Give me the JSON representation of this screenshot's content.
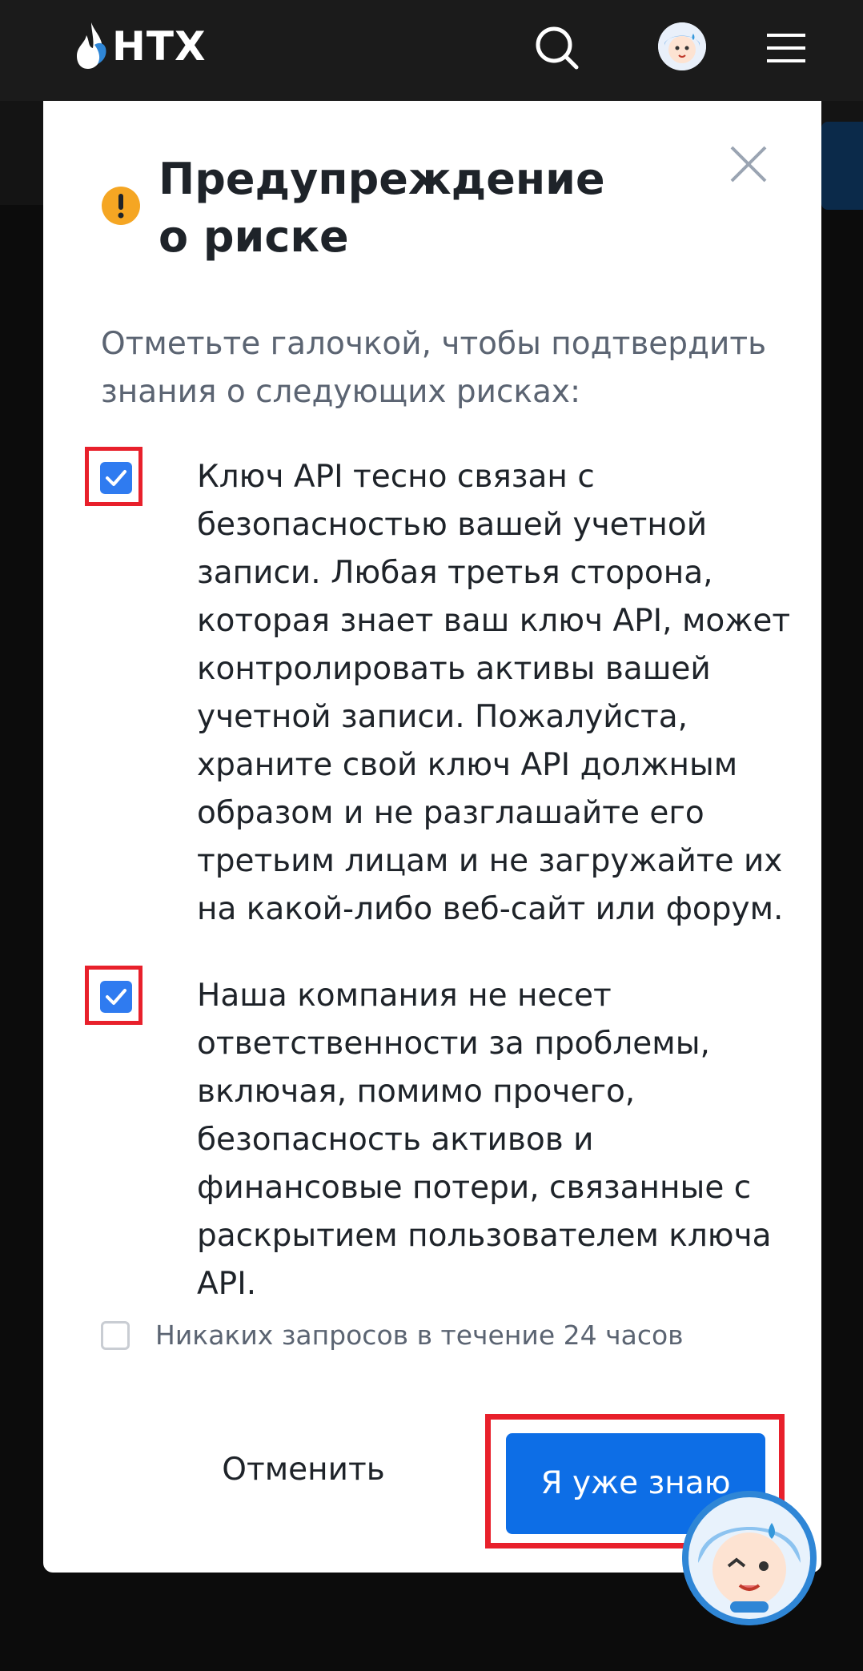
{
  "header": {
    "logo_text": "HTX",
    "search_icon": "search-icon",
    "avatar_icon": "avatar-icon",
    "menu_icon": "hamburger-menu-icon"
  },
  "modal": {
    "title": "Предупреждение о риске",
    "intro": "Отметьте галочкой, чтобы подтвердить знания о следующих рисках:",
    "items": [
      {
        "checked": true,
        "text": "Ключ API тесно связан с безопасностью вашей учетной записи. Любая третья сторона, которая знает ваш ключ API, может контролировать активы вашей учетной записи. Пожалуйста, храните свой ключ API должным образом и не разглашайте его третьим лицам и не загружайте их на какой-либо веб-сайт или форум."
      },
      {
        "checked": true,
        "text": "Наша компания не несет ответственности за проблемы, включая, помимо прочего, безопасность активов и финансовые потери, связанные с раскрытием пользователем ключа API."
      }
    ],
    "no_ask": {
      "checked": false,
      "label": "Никаких запросов в течение 24 часов"
    },
    "cancel_label": "Отменить",
    "confirm_label": "Я уже знаю"
  },
  "colors": {
    "accent": "#0d6ee6",
    "checkbox": "#2f7bf0",
    "warning": "#f5a623",
    "highlight": "#e8202b"
  }
}
